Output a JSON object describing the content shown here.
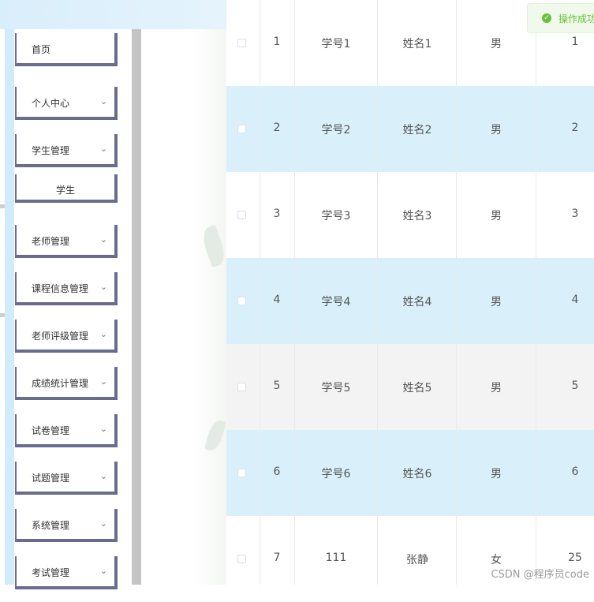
{
  "toast": {
    "message": "操作成功"
  },
  "sidebar": {
    "items": [
      {
        "label": "首页",
        "has_arrow": false
      },
      {
        "label": "个人中心",
        "has_arrow": true
      },
      {
        "label": "学生管理",
        "has_arrow": true
      },
      {
        "label": "学生",
        "has_arrow": false,
        "sub": true
      },
      {
        "label": "老师管理",
        "has_arrow": true
      },
      {
        "label": "课程信息管理",
        "has_arrow": true
      },
      {
        "label": "老师评级管理",
        "has_arrow": true
      },
      {
        "label": "成绩统计管理",
        "has_arrow": true
      },
      {
        "label": "试卷管理",
        "has_arrow": true
      },
      {
        "label": "试题管理",
        "has_arrow": true
      },
      {
        "label": "系统管理",
        "has_arrow": true
      },
      {
        "label": "考试管理",
        "has_arrow": true
      }
    ]
  },
  "table": {
    "rows": [
      {
        "index": "1",
        "student_id": "学号1",
        "name": "姓名1",
        "gender": "男",
        "age": "1",
        "style": "white"
      },
      {
        "index": "2",
        "student_id": "学号2",
        "name": "姓名2",
        "gender": "男",
        "age": "2",
        "style": "blue"
      },
      {
        "index": "3",
        "student_id": "学号3",
        "name": "姓名3",
        "gender": "男",
        "age": "3",
        "style": "white"
      },
      {
        "index": "4",
        "student_id": "学号4",
        "name": "姓名4",
        "gender": "男",
        "age": "4",
        "style": "blue"
      },
      {
        "index": "5",
        "student_id": "学号5",
        "name": "姓名5",
        "gender": "男",
        "age": "5",
        "style": "grey"
      },
      {
        "index": "6",
        "student_id": "学号6",
        "name": "姓名6",
        "gender": "男",
        "age": "6",
        "style": "blue"
      },
      {
        "index": "7",
        "student_id": "111",
        "name": "张静",
        "gender": "女",
        "age": "25",
        "style": "white"
      }
    ]
  },
  "watermark": "CSDN @程序员code",
  "colors": {
    "sidebar_strip": "#d2ebfa",
    "menu_border": "#6b6b8d",
    "row_blue": "#d9f0fb",
    "row_grey": "#f3f3f3",
    "toast_green": "#67c23a"
  }
}
